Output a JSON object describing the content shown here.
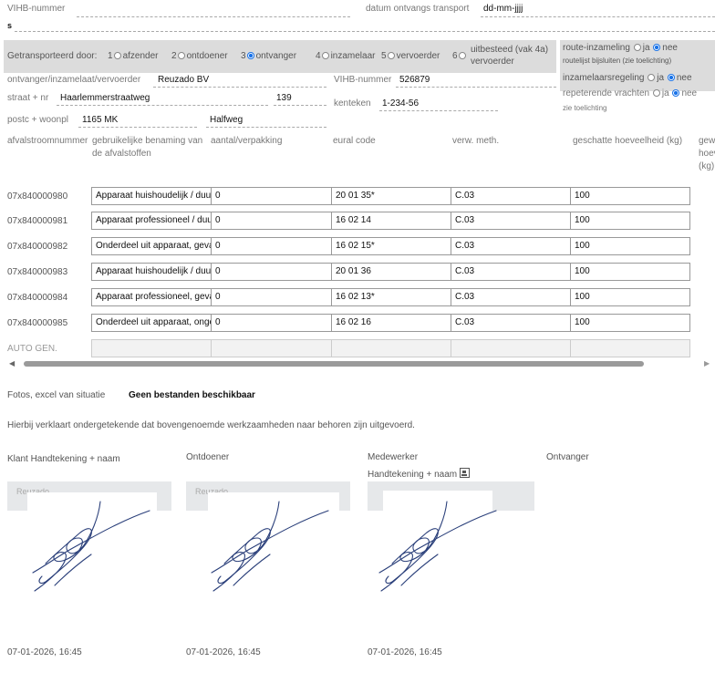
{
  "top": {
    "vihb_label": "VIHB-nummer",
    "datum_label": "datum ontvangs transport",
    "datum_value": "dd-mm-jjjj",
    "stray": "s"
  },
  "transport": {
    "label": "Getransporteerd door:",
    "options": [
      {
        "num": "1",
        "label": "afzender",
        "selected": false
      },
      {
        "num": "2",
        "label": "ontdoener",
        "selected": false
      },
      {
        "num": "3",
        "label": "ontvanger",
        "selected": true
      },
      {
        "num": "4",
        "label": "inzamelaar",
        "selected": false
      },
      {
        "num": "5",
        "label": "vervoerder",
        "selected": false
      },
      {
        "num": "6",
        "label": "uitbesteed (vak 4a) vervoerder",
        "selected": false
      }
    ]
  },
  "route": {
    "label": "route-inzameling",
    "ja": "ja",
    "nee": "nee",
    "note": "routelijst bijsluiten (zie toelichting)",
    "inzamel_label": "inzamelaarsregeling",
    "repeterend_label": "repeterende vrachten",
    "toelichting": "zie toelichting"
  },
  "party": {
    "ontvanger_label": "ontvanger/inzamelaat/vervoerder",
    "ontvanger_value": "Reuzado BV",
    "vihb_label": "VIHB-nummer",
    "vihb_value": "526879",
    "straat_label": "straat + nr",
    "straat_value": "Haarlemmerstraatweg",
    "nr_value": "139",
    "kenteken_label": "kenteken",
    "kenteken_value": "1-234-56",
    "postc_label": "postc + woonpl",
    "postc_value": "1165 MK",
    "plaats_value": "Halfweg"
  },
  "table": {
    "headers": {
      "nummer": "afvalstroomnummer",
      "benaming": "gebruikelijke benaming van de afvalstoffen",
      "aantal": "aantal/verpakking",
      "eural": "eural code",
      "verw": "verw. meth.",
      "geschat": "geschatte hoeveelheid (kg)",
      "gewogen": "gewogen hoeveelheid (kg)"
    },
    "rows": [
      {
        "code": "07x840000980",
        "benaming": "Apparaat huishoudelijk / duurzaam",
        "aantal": "0",
        "eural": "20 01 35*",
        "verw": "C.03",
        "geschat": "100"
      },
      {
        "code": "07x840000981",
        "benaming": "Apparaat professioneel / duurzaam",
        "aantal": "0",
        "eural": "16 02 14",
        "verw": "C.03",
        "geschat": "100"
      },
      {
        "code": "07x840000982",
        "benaming": "Onderdeel uit apparaat, gevaarlijk",
        "aantal": "0",
        "eural": "16 02 15*",
        "verw": "C.03",
        "geschat": "100"
      },
      {
        "code": "07x840000983",
        "benaming": "Apparaat huishoudelijk / duurzaam",
        "aantal": "0",
        "eural": "20 01 36",
        "verw": "C.03",
        "geschat": "100"
      },
      {
        "code": "07x840000984",
        "benaming": "Apparaat professioneel, gevaarlijk",
        "aantal": "0",
        "eural": "16 02 13*",
        "verw": "C.03",
        "geschat": "100"
      },
      {
        "code": "07x840000985",
        "benaming": "Onderdeel uit apparaat, ongevaarlijk",
        "aantal": "0",
        "eural": "16 02 16",
        "verw": "C.03",
        "geschat": "100"
      }
    ],
    "auto_label": "AUTO GEN."
  },
  "fotos": {
    "label": "Fotos, excel van situatie",
    "value": "Geen bestanden beschikbaar"
  },
  "declaration": "Hierbij verklaart ondergetekende dat bovengenoemde werkzaamheden naar behoren zijn uitgevoerd.",
  "signatures": {
    "klant_label": "Klant Handtekening + naam",
    "ontdoener_label": "Ontdoener",
    "medewerker_label": "Medewerker",
    "medewerker_sub": "Handtekening + naam",
    "ontvanger_label": "Ontvanger",
    "placeholder_klant": "Reuzado",
    "placeholder_ontdoener": "Reuzado",
    "date_klant": "07-01-2026, 16:45",
    "date_ontdoener": "07-01-2026, 16:45",
    "date_medewerker": "07-01-2026, 16:45"
  }
}
